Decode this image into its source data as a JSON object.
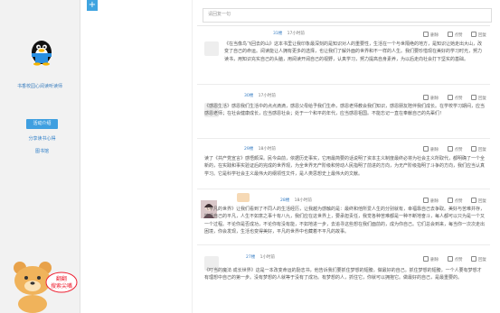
{
  "sidebar": {
    "corner_glyph": "+",
    "org_name": "书香校园心阅读听读师",
    "nav": [
      {
        "label": "活动介绍",
        "active": true
      },
      {
        "label": "分享读书心得",
        "active": false
      },
      {
        "label": "图书馆",
        "active": false
      }
    ],
    "mascot_text": "翻翻 搜索尖嘴"
  },
  "search": {
    "placeholder": "请回复一句"
  },
  "posts": [
    {
      "user": "31楼",
      "time": "17小时前",
      "actions": [
        "删除",
        "点赞",
        "回复"
      ],
      "text": "《在当像鸟飞回去的山》这本书里让我印象最深刻的是知识对人的重要性，生活在一个与世隔绝的地方，是知识让她走出大山，改变了自己的命运。阅读能让人拥有更多的选择，也让我们了解外面的世界和不一样的人生。我们要珍惜现在美好的学习时光，努力读书，用知识充实自己的头脑，用阅读开阔自己的视野，认真学习，努力提高自身素养，为以后走向社会打下坚实的基础。"
    },
    {
      "user": "30楼",
      "time": "17小时前",
      "actions": [
        "删除",
        "点赞",
        "回复"
      ],
      "text": "《感恩生活》感恩我们生活中的点点滴滴，感恩父母给予我们生命，感恩老师教会我们知识，感恩朋友陪伴我们成长。在学校学习期间，应当感恩老师；在社会健康成长，应当感恩社会；处于一个和平的年代，应当感恩祖国。不能忘记一直在奉献自己的先辈们！"
    },
    {
      "user": "29楼",
      "time": "18小时前",
      "actions": [
        "删除",
        "点赞",
        "回复"
      ],
      "text": "读了《共产党宣言》感悟颇深。民今由前，依据历史事实，它用最简要的话说明了资本主义制度最终必将为社会主义所取代，都明确了一个全新的，在实践和事实验证后的完成的世界观，为全世界无产阶级和劳动人民指明了前进的方向，为无产阶级指明了斗争的方向，我们应当认真学习。它是科学社会主义最伟大的纲领性文件，是人类思想史上最伟大的文献。"
    },
    {
      "user": "28楼",
      "time": "18小时前",
      "actions": [
        "删除",
        "点赞",
        "回复"
      ],
      "text": "《平凡的世界》让我们看到了不同人的生活经历，让我越为感触的是：最终和他所爱人生的分别就有，幸福靠自己去争取。美好与苦难并存，接受自己的平凡，人生不如意之事十有八九，我们应在这世界上，要承担责任，我觉各种苦难都是一种不断地奋斗，每人都可以只为是一个又一个过程。不论你是否成功，不论你有没有能，不如地进一步，去追寻这些想在我们面前的，成为你自己。它们总会到来，每当你一次次走出困境，你会发现，生活也变得美好，平凡的世界中也藏着不平凡的故事。"
    },
    {
      "user": "27楼",
      "time": "1小时前",
      "actions": [
        "删除",
        "点赞",
        "回复"
      ],
      "text": "《叮当的魔法·成长世界》这是一本改变命运的励志书，他告诉我们要抓住梦想的翅膀，做最好的自己。抓住梦想的翅膀，一个人要有梦想才有理想中自己的第一步。没有梦想的人就等于没有了成功。有梦想的人，抓住它，你就可以拥抱它。做最好的自己，是最重要的。"
    }
  ]
}
